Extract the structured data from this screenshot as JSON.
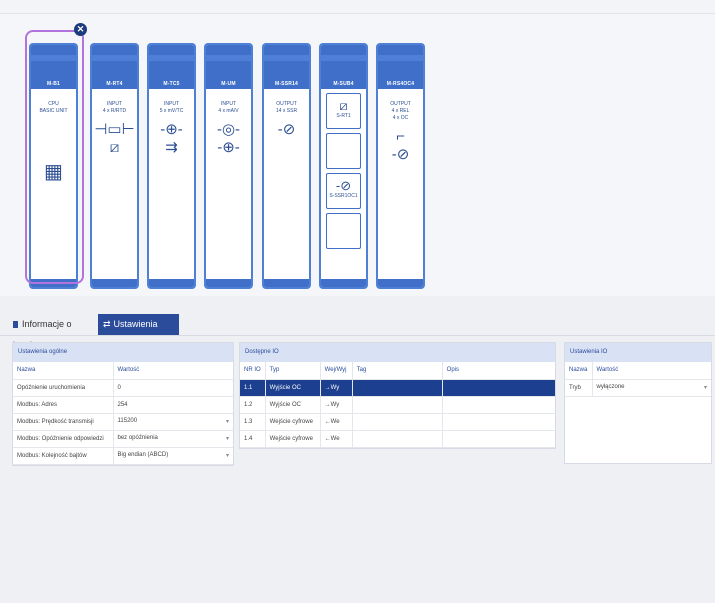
{
  "modules": [
    {
      "name": "M-B1",
      "lines": [
        "CPU",
        "BASIC UNIT"
      ],
      "icons": [
        "chip-icon"
      ]
    },
    {
      "name": "M-RT4",
      "lines": [
        "INPUT",
        "4 x R/RTD"
      ],
      "icons": [
        "resistor-icon",
        "thermistor-icon"
      ]
    },
    {
      "name": "M-TC5",
      "lines": [
        "INPUT",
        "5 x mV/TC"
      ],
      "icons": [
        "source-icon",
        "thermocouple-icon"
      ]
    },
    {
      "name": "M-UM",
      "lines": [
        "INPUT",
        "4 x mA/V"
      ],
      "icons": [
        "current-source-icon",
        "source-icon"
      ]
    },
    {
      "name": "M-SSR14",
      "lines": [
        "OUTPUT",
        "14 x SSR"
      ],
      "icons": [
        "transistor-icon"
      ]
    },
    {
      "name": "M-SUB4",
      "slots": [
        {
          "label": "S-RT1"
        },
        {
          "label": ""
        },
        {
          "label": "S-SSR1OC1"
        },
        {
          "label": ""
        }
      ]
    },
    {
      "name": "M-RS4OC4",
      "lines": [
        "OUTPUT",
        "4 x REL",
        "4 x OC"
      ],
      "icons": [
        "relay-icon",
        "transistor-icon"
      ]
    }
  ],
  "tabs": {
    "info": "Informacje o karcie",
    "settings": "Ustawienia karty"
  },
  "general": {
    "title": "Ustawienia ogólne",
    "columns": [
      "Nazwa",
      "Wartość"
    ],
    "rows": [
      [
        "Opóźnienie uruchomienia",
        "0"
      ],
      [
        "Modbus: Adres",
        "254"
      ],
      [
        "Modbus: Prędkość transmisji",
        "115200"
      ],
      [
        "Modbus: Opóźnienie odpowiedzi",
        "bez opóźnienia"
      ],
      [
        "Modbus: Kolejność bajtów",
        "Big endian (ABCD)"
      ]
    ]
  },
  "io": {
    "title": "Dostępne IO",
    "columns": [
      "NR IO",
      "Typ",
      "Wej/Wyj",
      "Tag",
      "Opis"
    ],
    "rows": [
      [
        "1.1",
        "Wyjście OC",
        "→Wy",
        "",
        ""
      ],
      [
        "1.2",
        "Wyjście OC",
        "→Wy",
        "",
        ""
      ],
      [
        "1.3",
        "Wejście cyfrowe",
        "←We",
        "",
        ""
      ],
      [
        "1.4",
        "Wejście cyfrowe",
        "←We",
        "",
        ""
      ]
    ]
  },
  "ioSettings": {
    "title": "Ustawienia IO",
    "columns": [
      "Nazwa",
      "Wartość"
    ],
    "rows": [
      [
        "Tryb",
        "wyłączone"
      ]
    ]
  }
}
